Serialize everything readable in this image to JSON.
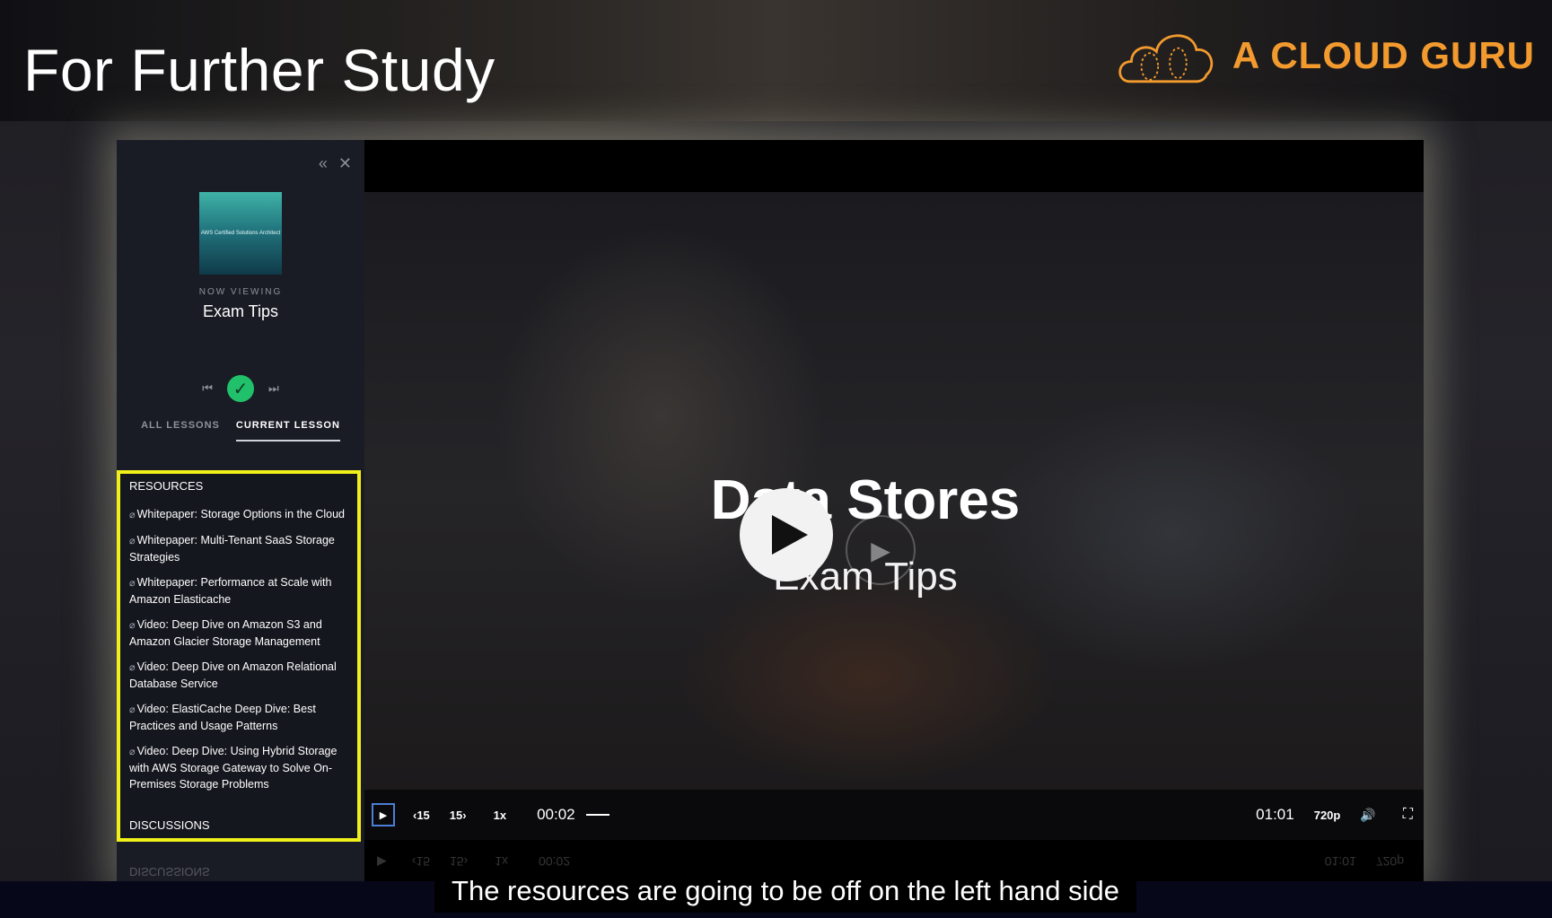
{
  "slide": {
    "title": "For Further Study",
    "logo_text": "A CLOUD GURU",
    "accent_color": "#f39a2e"
  },
  "sidebar": {
    "collapse_icon": "double-chevron-left-icon",
    "close_icon": "close-icon",
    "cover_text": "AWS Certified Solutions Architect",
    "now_viewing_label": "NOW VIEWING",
    "lesson_title": "Exam Tips",
    "tabs": [
      {
        "label": "ALL LESSONS",
        "active": false
      },
      {
        "label": "CURRENT LESSON",
        "active": true
      }
    ],
    "resources_heading": "RESOURCES",
    "resources": [
      {
        "label": "Whitepaper: Storage Options in the Cloud"
      },
      {
        "label": "Whitepaper: Multi-Tenant SaaS Storage Strategies"
      },
      {
        "label": "Whitepaper: Performance at Scale with Amazon Elasticache"
      },
      {
        "label": "Video: Deep Dive on Amazon S3 and Amazon Glacier Storage Management"
      },
      {
        "label": "Video: Deep Dive on Amazon Relational Database Service"
      },
      {
        "label": "Video: ElastiCache Deep Dive: Best Practices and Usage Patterns"
      },
      {
        "label": "Video: Deep Dive: Using Hybrid Storage with AWS Storage Gateway to Solve On-Premises Storage Problems"
      }
    ],
    "discussions_heading": "DISCUSSIONS",
    "highlight_color": "#f1f01b"
  },
  "video": {
    "title": "Data Stores",
    "subtitle": "Exam Tips",
    "controls": {
      "rewind_label": "‹15",
      "forward_label": "15›",
      "speed_label": "1x",
      "current_time": "00:02",
      "total_time": "01:01",
      "quality": "720p"
    }
  },
  "caption": {
    "text": "The resources are going to be off on the left hand side"
  }
}
